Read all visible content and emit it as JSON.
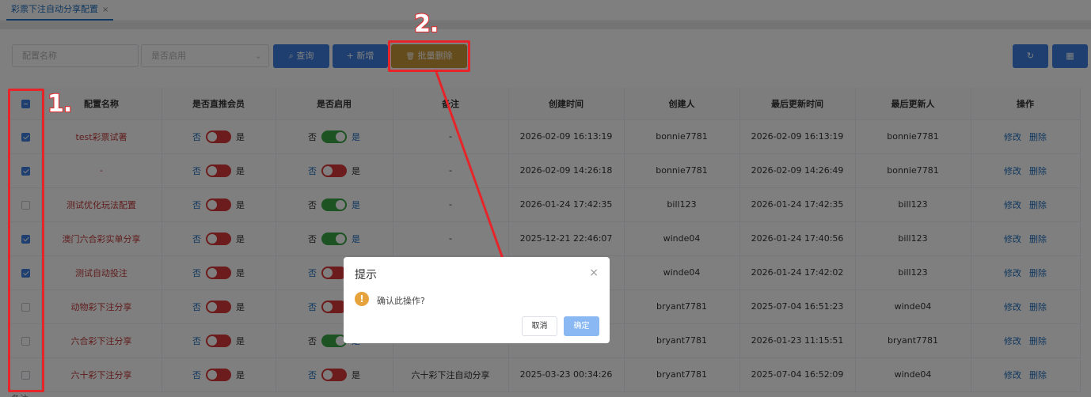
{
  "tab": {
    "label": "彩票下注自动分享配置",
    "close": "×"
  },
  "filters": {
    "name_placeholder": "配置名称",
    "enabled_placeholder": "是否启用",
    "enabled_arrow": "⌄"
  },
  "toolbar": {
    "search_icon": "⌕",
    "search_label": "查询",
    "add_icon": "+",
    "add_label": "新增",
    "batch_delete_icon": "🗑",
    "batch_delete_label": "批量删除",
    "refresh_icon": "↻",
    "columns_icon": "▦"
  },
  "columns": [
    "",
    "配置名称",
    "是否直推会员",
    "是否启用",
    "备注",
    "创建时间",
    "创建人",
    "最后更新时间",
    "最后更新人",
    "操作"
  ],
  "switch_labels": {
    "off": "否",
    "on": "是"
  },
  "actions": {
    "edit": "修改",
    "delete": "删除"
  },
  "rows": [
    {
      "checked": true,
      "name": "test彩票试著",
      "direct_on": false,
      "enabled_on": true,
      "remark": "-",
      "created": "2026-02-09 16:13:19",
      "creator": "bonnie7781",
      "updated": "2026-02-09 16:13:19",
      "updater": "bonnie7781"
    },
    {
      "checked": true,
      "name": "-",
      "direct_on": false,
      "enabled_on": false,
      "remark": "-",
      "created": "2026-02-09 14:26:18",
      "creator": "bonnie7781",
      "updated": "2026-02-09 14:26:49",
      "updater": "bonnie7781"
    },
    {
      "checked": false,
      "name": "测试优化玩法配置",
      "direct_on": false,
      "enabled_on": true,
      "remark": "-",
      "created": "2026-01-24 17:42:35",
      "creator": "bill123",
      "updated": "2026-01-24 17:42:35",
      "updater": "bill123"
    },
    {
      "checked": true,
      "name": "澳门六合彩实单分享",
      "direct_on": false,
      "enabled_on": true,
      "remark": "-",
      "created": "2025-12-21 22:46:07",
      "creator": "winde04",
      "updated": "2026-01-24 17:40:56",
      "updater": "bill123"
    },
    {
      "checked": true,
      "name": "测试自动投注",
      "direct_on": false,
      "enabled_on": false,
      "remark": "",
      "created": "",
      "creator": "winde04",
      "updated": "2026-01-24 17:42:02",
      "updater": "bill123"
    },
    {
      "checked": false,
      "name": "动物彩下注分享",
      "direct_on": false,
      "enabled_on": false,
      "remark": "",
      "created": "",
      "creator": "bryant7781",
      "updated": "2025-07-04 16:51:23",
      "updater": "winde04"
    },
    {
      "checked": false,
      "name": "六合彩下注分享",
      "direct_on": false,
      "enabled_on": true,
      "remark": "",
      "created": "",
      "creator": "bryant7781",
      "updated": "2026-01-23 11:15:51",
      "updater": "bryant7781"
    },
    {
      "checked": false,
      "name": "六十彩下注分享",
      "direct_on": false,
      "enabled_on": false,
      "remark": "六十彩下注自动分享",
      "created": "2025-03-23 00:34:26",
      "creator": "bryant7781",
      "updated": "2025-07-04 16:52:09",
      "updater": "winde04"
    }
  ],
  "dialog": {
    "title": "提示",
    "close": "×",
    "icon": "!",
    "message": "确认此操作?",
    "cancel_label": "取消",
    "confirm_label": "确定"
  },
  "annotations": {
    "step1": "1.",
    "step2": "2."
  },
  "footnote": "备注"
}
